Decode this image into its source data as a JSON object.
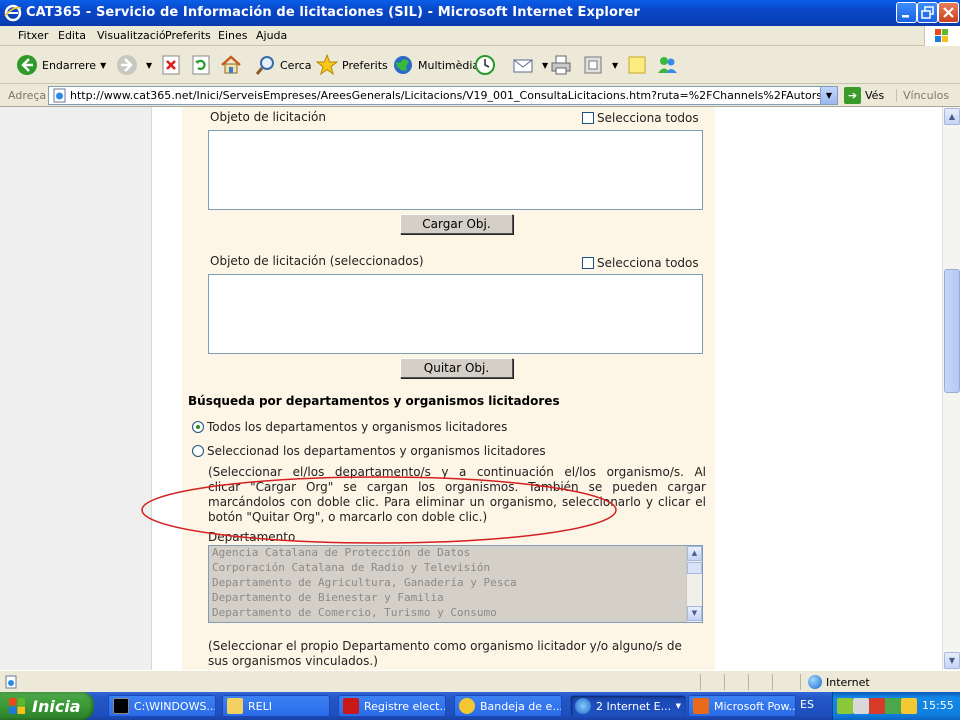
{
  "window": {
    "title": "CAT365 - Servicio de Información de licitaciones (SIL) - Microsoft Internet Explorer"
  },
  "menu": [
    "Fitxer",
    "Edita",
    "Visualització",
    "Preferits",
    "Eines",
    "Ajuda"
  ],
  "toolbar": {
    "back": "Endarrere",
    "search": "Cerca",
    "favorites": "Preferits",
    "media": "Multimèdia"
  },
  "address": {
    "label": "Adreça",
    "url": "http://www.cat365.net/Inici/ServeisEmpreses/AreesGenerals/Licitacions/V19_001_ConsultaLicitacions.htm?ruta=%2FChannels%2FAutors%2FInici%2FServeisEmpresa",
    "go": "Vés",
    "links": "Vínculos"
  },
  "form": {
    "object_label": "Objeto de licitación",
    "select_all": "Selecciona todos",
    "load_obj": "Cargar Obj.",
    "selected_label": "Objeto de licitación (seleccionados)",
    "select_all_2": "Selecciona todos",
    "remove_obj": "Quitar Obj.",
    "dept_heading": "Búsqueda por departamentos y organismos licitadores",
    "radio_all": "Todos los departamentos y organismos licitadores",
    "radio_select": "Seleccionad los departamentos y organismos licitadores",
    "instructions": [
      "(Seleccionar el/los departamento/s y a continuación el/los organismo/s. Al",
      "clicar \"Cargar Org\" se cargan los organismos. También se pueden cargar",
      "marcándolos con doble clic. Para eliminar un organismo, seleccionarlo y clicar el",
      "botón \"Quitar Org\", o marcarlo con doble clic.)"
    ],
    "dept_label": "Departamento",
    "departments": [
      "Agencia Catalana de Protección de Datos",
      "Corporación Catalana de Radio y Televisión",
      "Departamento de Agricultura, Ganadería y Pesca",
      "Departamento de Bienestar y Familia",
      "Departamento de Comercio, Turismo y Consumo"
    ],
    "note": [
      "(Seleccionar el propio Departamento como organismo licitador y/o alguno/s de",
      "sus organismos vinculados.)"
    ]
  },
  "status": {
    "zone": "Internet"
  },
  "taskbar": {
    "start": "Inicia",
    "tasks": [
      "C:\\WINDOWS...",
      "RELI",
      "Registre elect...",
      "Bandeja de e...",
      "2 Internet E...",
      "Microsoft Pow..."
    ],
    "lang": "ES",
    "clock": "15:55"
  },
  "colors": {
    "content_bg": "#fdf5e6",
    "highlight_ellipse": "#d42020",
    "taskbar": "#2457c7",
    "start_button": "#3a9a36"
  }
}
